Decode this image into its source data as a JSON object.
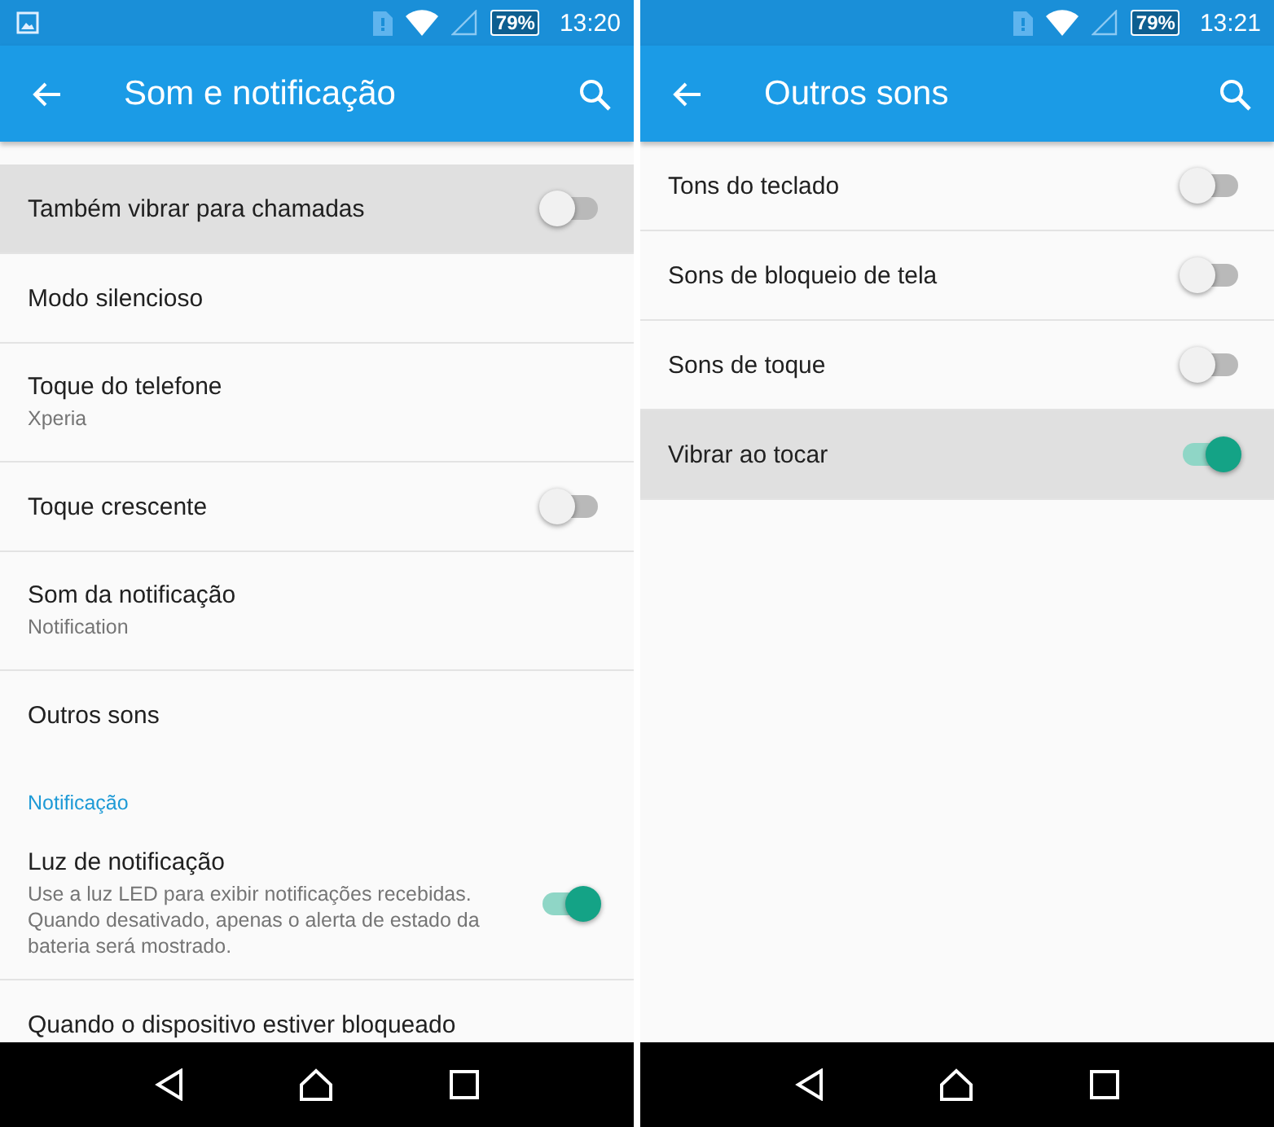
{
  "screens": [
    {
      "status_bar": {
        "notification_icon": true,
        "battery": "79%",
        "time": "13:20"
      },
      "title": "Som e notificação",
      "items": [
        {
          "kind": "toggle",
          "title": "Também vibrar para chamadas",
          "on": false,
          "highlighted": true
        },
        {
          "kind": "link",
          "title": "Modo silencioso",
          "highlighted": false
        },
        {
          "kind": "link",
          "title": "Toque do telefone",
          "summary": "Xperia",
          "highlighted": false
        },
        {
          "kind": "toggle",
          "title": "Toque crescente",
          "on": false,
          "highlighted": false
        },
        {
          "kind": "link",
          "title": "Som da notificação",
          "summary": "Notification",
          "highlighted": false
        },
        {
          "kind": "link",
          "title": "Outros sons",
          "highlighted": false
        },
        {
          "kind": "header",
          "title": "Notificação"
        },
        {
          "kind": "toggle",
          "title": "Luz de notificação",
          "summary": "Use a luz LED para exibir notificações recebidas. Quando desativado, apenas o alerta de estado da bateria será mostrado.",
          "on": true,
          "highlighted": false
        },
        {
          "kind": "link",
          "title": "Quando o dispositivo estiver bloqueado",
          "highlighted": false
        }
      ]
    },
    {
      "status_bar": {
        "notification_icon": false,
        "battery": "79%",
        "time": "13:21"
      },
      "title": "Outros sons",
      "items": [
        {
          "kind": "toggle",
          "title": "Tons do teclado",
          "on": false,
          "highlighted": false
        },
        {
          "kind": "toggle",
          "title": "Sons de bloqueio de tela",
          "on": false,
          "highlighted": false
        },
        {
          "kind": "toggle",
          "title": "Sons de toque",
          "on": false,
          "highlighted": false
        },
        {
          "kind": "toggle",
          "title": "Vibrar ao tocar",
          "on": true,
          "highlighted": true
        }
      ]
    }
  ]
}
